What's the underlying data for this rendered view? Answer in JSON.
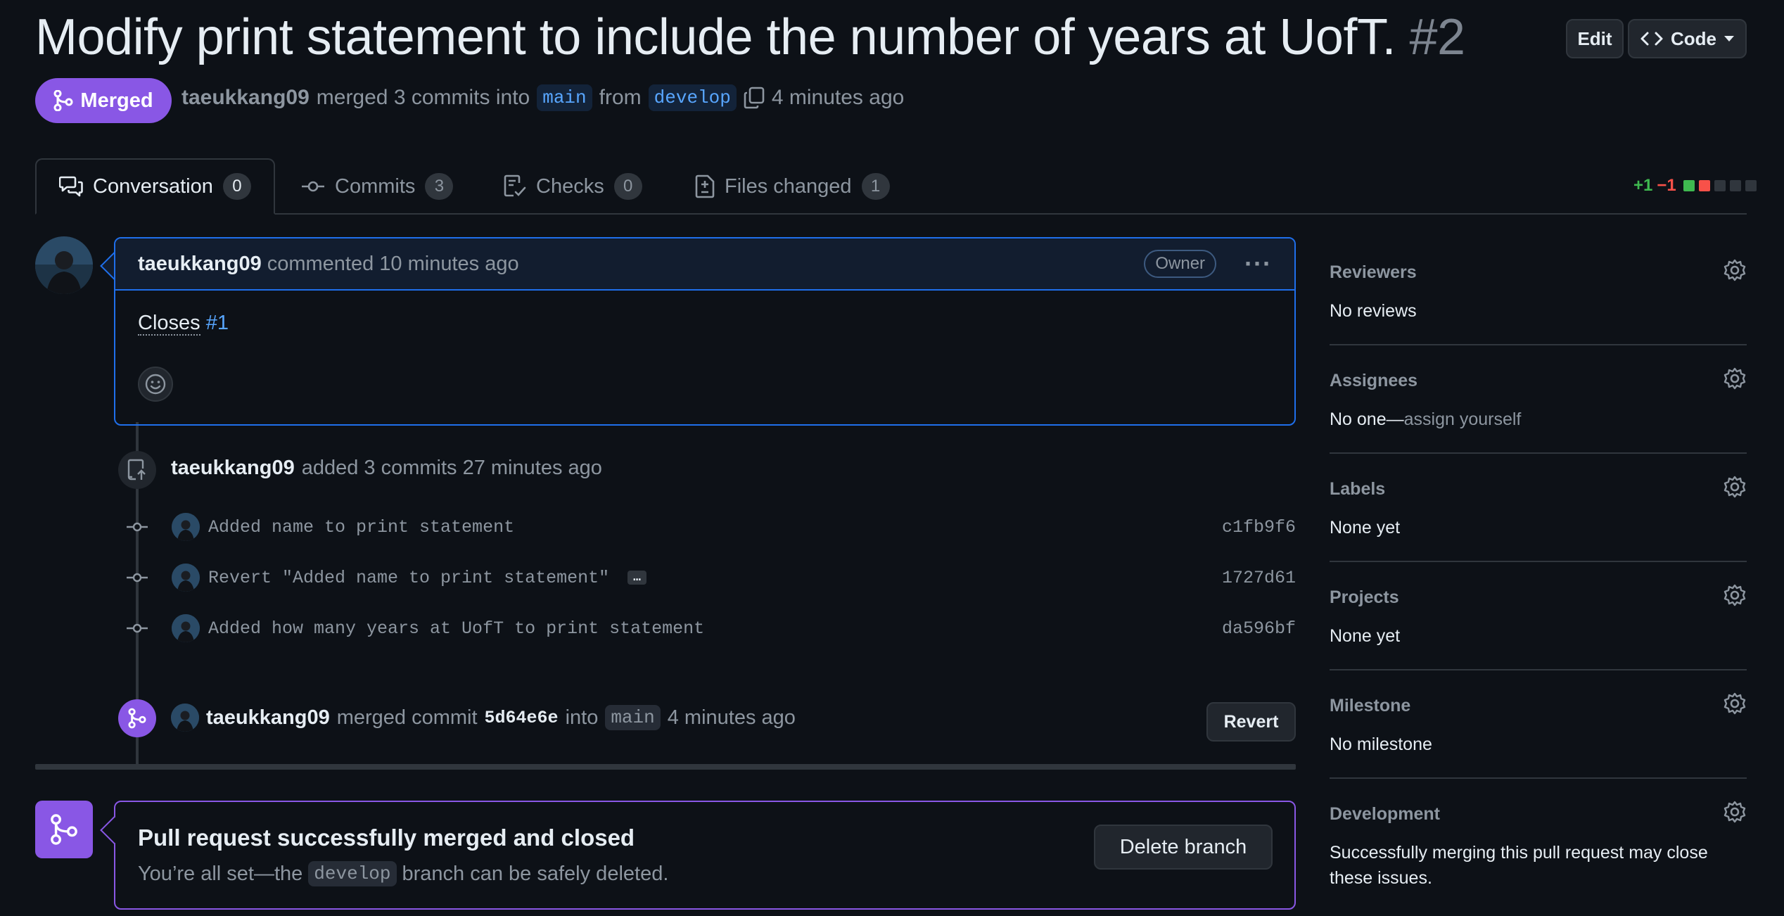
{
  "pr": {
    "title": "Modify print statement to include the number of years at UofT.",
    "number": "#2",
    "state": "Merged",
    "author": "taeukkang09",
    "merged_text": "merged 3 commits into",
    "base_branch": "main",
    "from_text": "from",
    "head_branch": "develop",
    "time": "4 minutes ago"
  },
  "header_buttons": {
    "edit": "Edit",
    "code": "Code"
  },
  "tabs": [
    {
      "label": "Conversation",
      "count": "0"
    },
    {
      "label": "Commits",
      "count": "3"
    },
    {
      "label": "Checks",
      "count": "0"
    },
    {
      "label": "Files changed",
      "count": "1"
    }
  ],
  "diffstat": {
    "additions": "+1",
    "deletions": "−1"
  },
  "comment": {
    "author": "taeukkang09",
    "action": "commented 10 minutes ago",
    "badge": "Owner",
    "body_prefix": "Closes",
    "issue_ref": "#1"
  },
  "commits_event": {
    "author": "taeukkang09",
    "action": "added 3 commits 27 minutes ago",
    "commits": [
      {
        "message": "Added name to print statement",
        "sha": "c1fb9f6"
      },
      {
        "message": "Revert \"Added name to print statement\"",
        "sha": "1727d61",
        "ellipsis": "…"
      },
      {
        "message": "Added how many years at UofT to print statement",
        "sha": "da596bf"
      }
    ]
  },
  "merge_event": {
    "author": "taeukkang09",
    "action": "merged commit",
    "sha": "5d64e6e",
    "into": "into",
    "branch": "main",
    "time": "4 minutes ago",
    "revert_label": "Revert"
  },
  "merged_box": {
    "title": "Pull request successfully merged and closed",
    "sub_prefix": "You’re all set—the",
    "branch": "develop",
    "sub_suffix": "branch can be safely deleted.",
    "delete_label": "Delete branch"
  },
  "sidebar": {
    "reviewers": {
      "label": "Reviewers",
      "value": "No reviews"
    },
    "assignees": {
      "label": "Assignees",
      "value": "No one—",
      "link": "assign yourself"
    },
    "labels": {
      "label": "Labels",
      "value": "None yet"
    },
    "projects": {
      "label": "Projects",
      "value": "None yet"
    },
    "milestone": {
      "label": "Milestone",
      "value": "No milestone"
    },
    "development": {
      "label": "Development",
      "value": "Successfully merging this pull request may close these issues."
    }
  },
  "colors": {
    "merged_purple": "#8957e5",
    "link_blue": "#58a6ff",
    "bg": "#0d1117"
  }
}
